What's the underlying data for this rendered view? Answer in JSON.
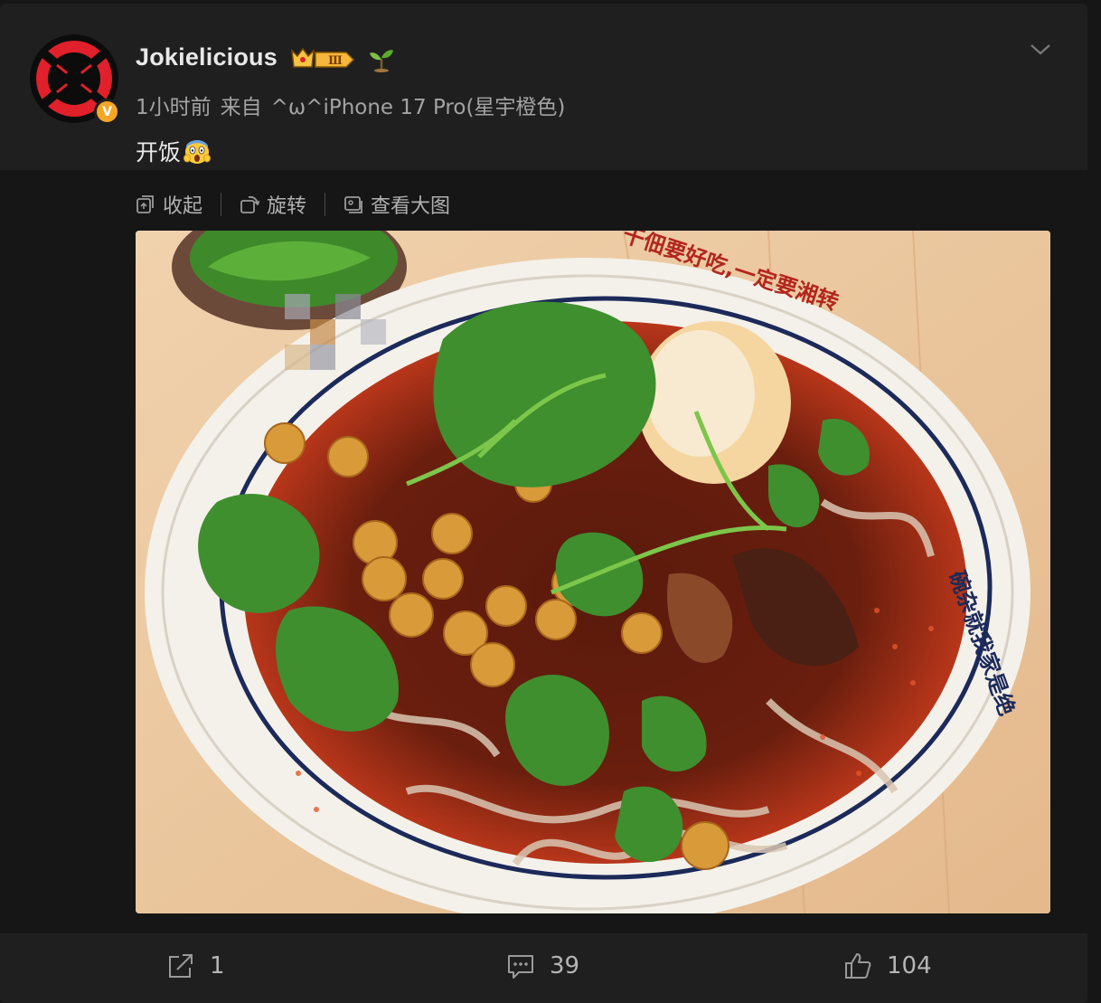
{
  "post": {
    "username": "Jokielicious",
    "level_badge": "Ⅲ",
    "verified_mark": "V",
    "time": "1小时前",
    "source_prefix": "来自",
    "source": "^ω^iPhone 17 Pro(星宇橙色)",
    "text": "开饭",
    "emoji": "screaming-face-emoji"
  },
  "media_toolbar": {
    "collapse_label": "收起",
    "rotate_label": "旋转",
    "view_large_label": "查看大图"
  },
  "photo": {
    "bowl_text_top": "干佃要好吃,一定要湘转",
    "bowl_text_right": "碗杂就我家是绝",
    "description_icon": "noodle-bowl-photo"
  },
  "actions": {
    "repost_count": "1",
    "comment_count": "39",
    "like_count": "104"
  },
  "colors": {
    "background": "#161616",
    "card": "#1f1f1f",
    "text_primary": "#e8e8e8",
    "text_secondary": "#a3a3a3",
    "verified": "#f5a623",
    "avatar_red": "#e0202a"
  }
}
